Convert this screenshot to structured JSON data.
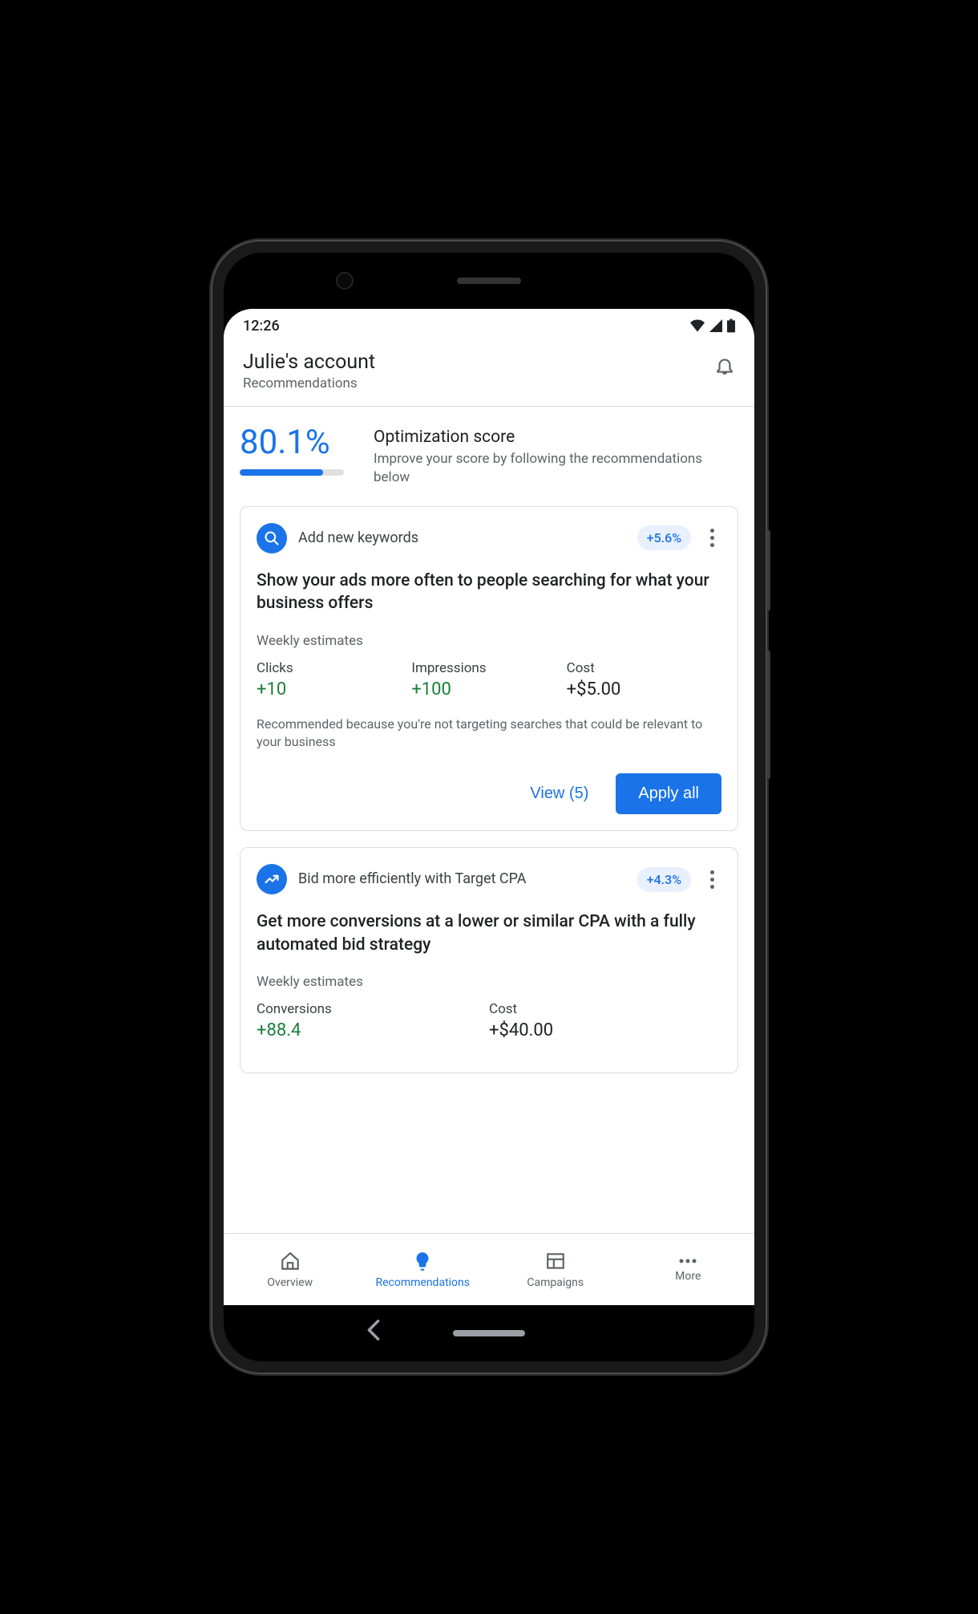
{
  "status": {
    "time": "12:26"
  },
  "header": {
    "account_name": "Julie's account",
    "subtitle": "Recommendations"
  },
  "score": {
    "value": "80.1%",
    "percent": 80.1,
    "title": "Optimization score",
    "description": "Improve your score by following the recommendations below"
  },
  "cards": [
    {
      "icon": "search",
      "title": "Add new keywords",
      "badge": "+5.6%",
      "headline": "Show your ads more often to people searching for what your business offers",
      "estimates_label": "Weekly estimates",
      "metrics": [
        {
          "label": "Clicks",
          "value": "+10",
          "color": "green"
        },
        {
          "label": "Impressions",
          "value": "+100",
          "color": "green"
        },
        {
          "label": "Cost",
          "value": "+$5.00",
          "color": "dark"
        }
      ],
      "reason": "Recommended because you're not targeting searches that could be relevant to your business",
      "view_label": "View (5)",
      "apply_label": "Apply all"
    },
    {
      "icon": "trend",
      "title": "Bid more efficiently with Target CPA",
      "badge": "+4.3%",
      "headline": "Get more conversions at a lower or similar CPA with a fully automated bid strategy",
      "estimates_label": "Weekly estimates",
      "metrics": [
        {
          "label": "Conversions",
          "value": "+88.4",
          "color": "green"
        },
        {
          "label": "Cost",
          "value": "+$40.00",
          "color": "dark"
        }
      ]
    }
  ],
  "nav": {
    "overview": "Overview",
    "recommendations": "Recommendations",
    "campaigns": "Campaigns",
    "more": "More"
  }
}
